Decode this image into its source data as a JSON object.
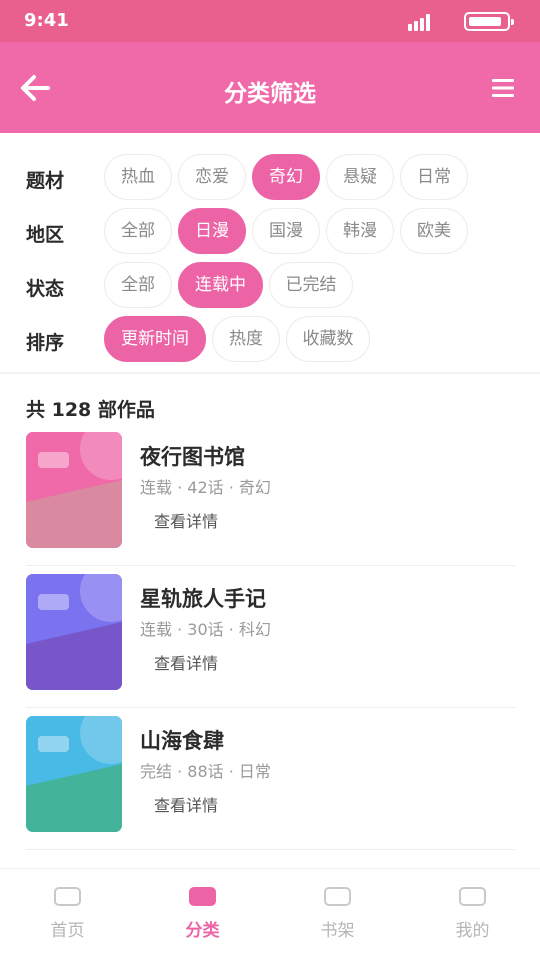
{
  "status_bar": {
    "time": "9:41"
  },
  "header": {
    "title": "分类筛选",
    "back_icon": "arrow-left-icon",
    "menu_icon": "hamburger-menu-icon"
  },
  "filters": [
    {
      "label": "题材",
      "options": [
        "热血",
        "恋爱",
        "奇幻",
        "悬疑",
        "日常"
      ],
      "selected": "奇幻"
    },
    {
      "label": "地区",
      "options": [
        "全部",
        "日漫",
        "国漫",
        "韩漫",
        "欧美"
      ],
      "selected": "日漫"
    },
    {
      "label": "状态",
      "options": [
        "全部",
        "连载中",
        "已完结"
      ],
      "selected": "连载中"
    },
    {
      "label": "排序",
      "options": [
        "更新时间",
        "热度",
        "收藏数"
      ],
      "selected": "更新时间"
    }
  ],
  "result_count": "共 128 部作品",
  "works": [
    {
      "title": "夜行图书馆",
      "meta": "连载 · 42话 · 奇幻",
      "action": "查看详情",
      "colors": [
        "#f06aa9",
        "#f7a1c4",
        "#d98aa0"
      ]
    },
    {
      "title": "星轨旅人手记",
      "meta": "连载 · 30话 · 科幻",
      "action": "查看详情",
      "colors": [
        "#7b72f0",
        "#8ea0f5",
        "#7656c8"
      ]
    },
    {
      "title": "山海食肆",
      "meta": "完结 · 88话 · 日常",
      "action": "查看详情",
      "colors": [
        "#49b9e6",
        "#74d7ea",
        "#43b39a"
      ]
    }
  ],
  "tabs": [
    {
      "label": "首页",
      "active": false
    },
    {
      "label": "分类",
      "active": true
    },
    {
      "label": "书架",
      "active": false
    },
    {
      "label": "我的",
      "active": false
    }
  ],
  "colors": {
    "status_bar": "#e9608e",
    "header": "#f06aa9",
    "accent": "#ec64a6"
  }
}
